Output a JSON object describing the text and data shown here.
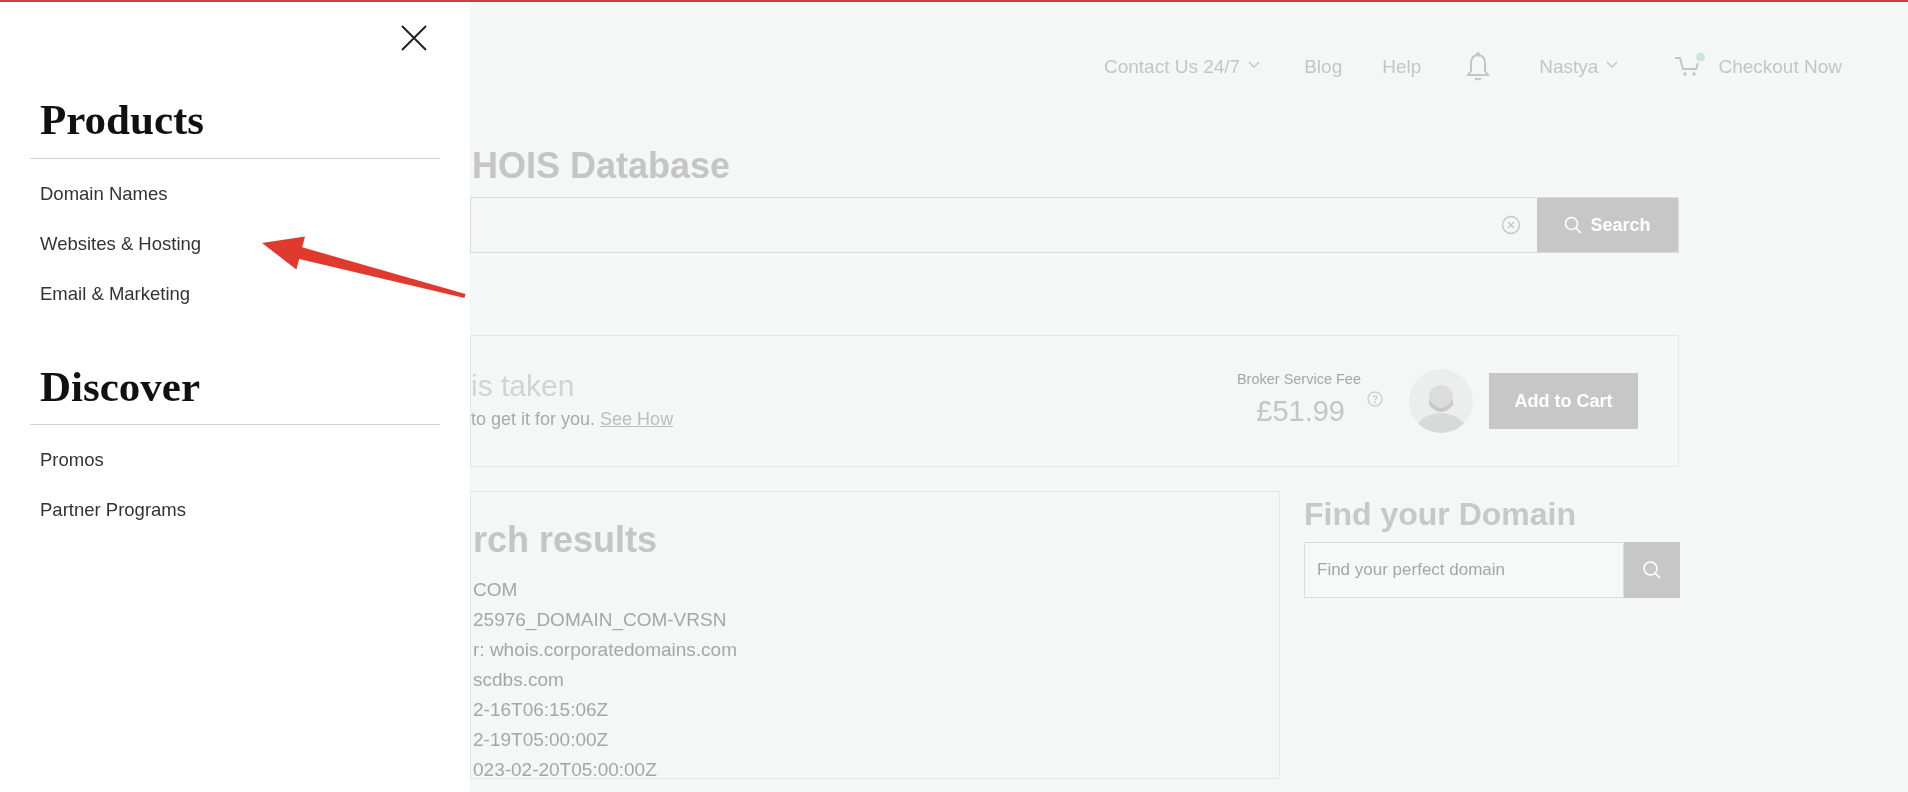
{
  "drawer": {
    "sections": [
      {
        "title": "Products",
        "items": [
          "Domain Names",
          "Websites & Hosting",
          "Email & Marketing"
        ]
      },
      {
        "title": "Discover",
        "items": [
          "Promos",
          "Partner Programs"
        ]
      }
    ]
  },
  "header": {
    "nav": [
      {
        "kind": "dropdown",
        "label": "Contact Us 24/7"
      },
      {
        "kind": "link",
        "label": "Blog"
      },
      {
        "kind": "link",
        "label": "Help"
      },
      {
        "kind": "bell"
      },
      {
        "kind": "dropdown",
        "label": "Nastya"
      },
      {
        "kind": "cart",
        "label": "Checkout Now"
      }
    ]
  },
  "page_title": "HOIS Database",
  "search": {
    "button": "Search"
  },
  "broker": {
    "headline": "is taken",
    "text": "to get it for you.",
    "link": "See How",
    "fee_label": "Broker Service Fee",
    "price": "£51.99",
    "button": "Add to Cart"
  },
  "results": {
    "title": "rch results",
    "lines": [
      "COM",
      "25976_DOMAIN_COM-VRSN",
      "r: whois.corporatedomains.com",
      "scdbs.com",
      "2-16T06:15:06Z",
      "2-19T05:00:00Z",
      "023-02-20T05:00:00Z"
    ]
  },
  "find_domain": {
    "title": "Find your Domain",
    "placeholder": "Find your perfect domain"
  }
}
